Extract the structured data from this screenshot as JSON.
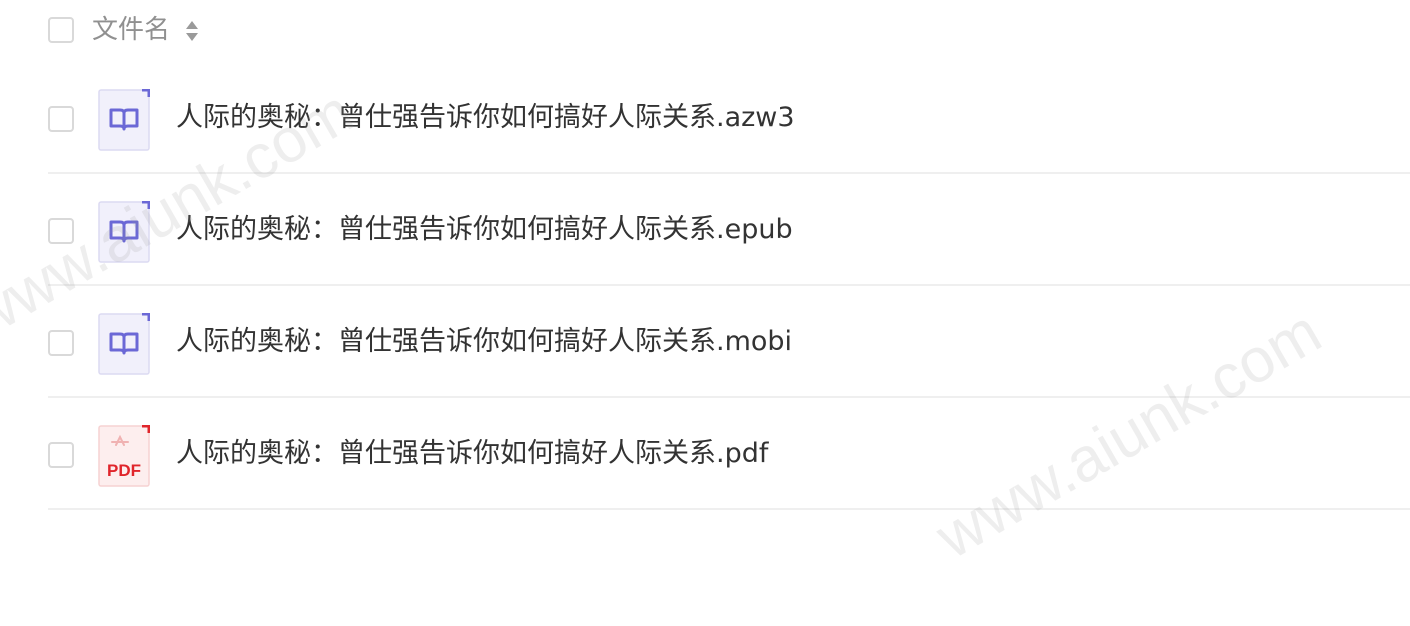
{
  "header": {
    "column_label": "文件名",
    "sort_icon": "sort-icon"
  },
  "files": [
    {
      "name": "人际的奥秘：曾仕强告诉你如何搞好人际关系.azw3",
      "icon": "ebook-file-icon"
    },
    {
      "name": "人际的奥秘：曾仕强告诉你如何搞好人际关系.epub",
      "icon": "ebook-file-icon"
    },
    {
      "name": "人际的奥秘：曾仕强告诉你如何搞好人际关系.mobi",
      "icon": "ebook-file-icon"
    },
    {
      "name": "人际的奥秘：曾仕强告诉你如何搞好人际关系.pdf",
      "icon": "pdf-file-icon",
      "icon_label": "PDF"
    }
  ],
  "watermark": "www.aiunk.com",
  "colors": {
    "ebook_icon_accent": "#6b68d6",
    "ebook_icon_bg": "#f1f0fb",
    "pdf_icon_accent": "#e0252b",
    "pdf_icon_bg": "#fdeeee",
    "divider": "#efefef",
    "checkbox_border": "#d9d9d9"
  }
}
